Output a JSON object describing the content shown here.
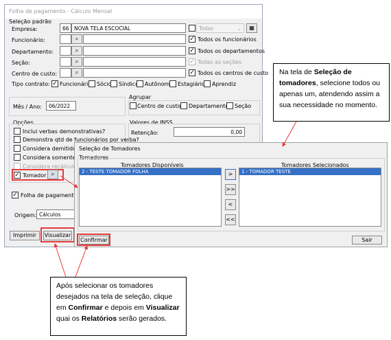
{
  "window": {
    "title": "Folha de pagamento - Cálculo Mensal",
    "close_glyph": "✕",
    "selecao_padrao": "Seleção padrão",
    "empresa_label": "Empresa:",
    "empresa_code": "66",
    "empresa_name": "NOVA TELA ESCOCIAL",
    "todas_select": "Todas",
    "funcionario_label": "Funcionário:",
    "departamento_label": "Departamento:",
    "secao_label": "Seção:",
    "centro_label": "Centro de custo:",
    "todos_funcionarios": "Todos os funcionários",
    "todos_departamentos": "Todos os departamentos",
    "todas_secoes": "Todas as seções",
    "todos_centros": "Todos os centros de custo",
    "tipo_contrato_label": "Tipo contrato:",
    "contrato": [
      "Funcionário",
      "Sócio",
      "Síndico",
      "Autônomo",
      "Estagiário",
      "Aprendiz"
    ],
    "agrupar_label": "Agrupar",
    "agrupar_items": [
      "Centro de custo",
      "Departamento",
      "Seção"
    ],
    "mes_ano_label": "Mês / Ano:",
    "mes_ano_value": "06/2022",
    "opcoes_label": "Opções",
    "opcoes": [
      "Inclui verbas demonstrativas?",
      "Demonstra qtd de funcionários por verba?",
      "Considera demitidos no período",
      "Considera somente dem",
      "Considera recálculos d"
    ],
    "tomador_label": "Tomador",
    "valores_inss_label": "Valores de INSS",
    "retencao_label": "Retenção:",
    "retencao_value": "0,00",
    "folha_complementar": "Folha de pagamento co",
    "origem_label": "Origem:",
    "origem_value": "Cálculos",
    "imprimir": "Imprimir",
    "visualizar": "Visualizar"
  },
  "dialog": {
    "title": "Seleção de Tomadores",
    "group_label": "Tomadores",
    "disponiveis_header": "Tomadores Disponíveis",
    "selecionados_header": "Tomadores Selecionados",
    "disponiveis": [
      "2 - TESTE TOMADOR FOLHA"
    ],
    "selecionados": [
      "1 - TOMADOR TESTE"
    ],
    "move_buttons": [
      ">",
      ">>",
      "<",
      "<<"
    ],
    "confirmar": "Confirmar",
    "sair": "Sair"
  },
  "notes": {
    "note1": {
      "p1": "Na tela de ",
      "b1": "Seleção de tomadores",
      "p2": ", selecione todos ou apenas um, atendendo assim a sua necessidade no momento."
    },
    "note2": {
      "p1": "Após selecionar os tomadores desejados na tela de seleção, clique em ",
      "b1": "Confirmar",
      "p2": " e depois em ",
      "b2": "Visualizar",
      "p3": " quai os ",
      "b3": "Relatórios",
      "p4": " serão gerados."
    }
  },
  "icons": {
    "find": "binoculars-icon",
    "check_glyph": "✓",
    "find_glyph": "⌕"
  }
}
